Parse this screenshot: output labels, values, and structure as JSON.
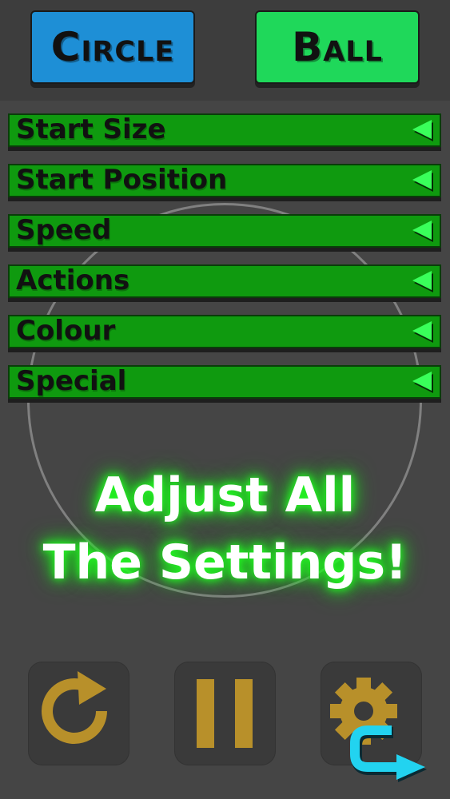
{
  "header": {
    "circle_label": "Circle",
    "ball_label": "Ball"
  },
  "menu": {
    "items": [
      {
        "label": "Start Size"
      },
      {
        "label": "Start Position"
      },
      {
        "label": "Speed"
      },
      {
        "label": "Actions"
      },
      {
        "label": "Colour"
      },
      {
        "label": "Special"
      }
    ]
  },
  "headline": {
    "line1": "Adjust All",
    "line2": "The Settings!"
  },
  "controls": {
    "icons": [
      "restart-icon",
      "pause-icon",
      "settings-icon",
      "swap-icon"
    ]
  },
  "colors": {
    "circle_button": "#1e8fd6",
    "ball_button": "#1fd85a",
    "menu_green": "#0f9a0f",
    "arrow_green": "#39ff5a",
    "control_gold": "#b8902a",
    "swap_cyan": "#22d3f0"
  }
}
